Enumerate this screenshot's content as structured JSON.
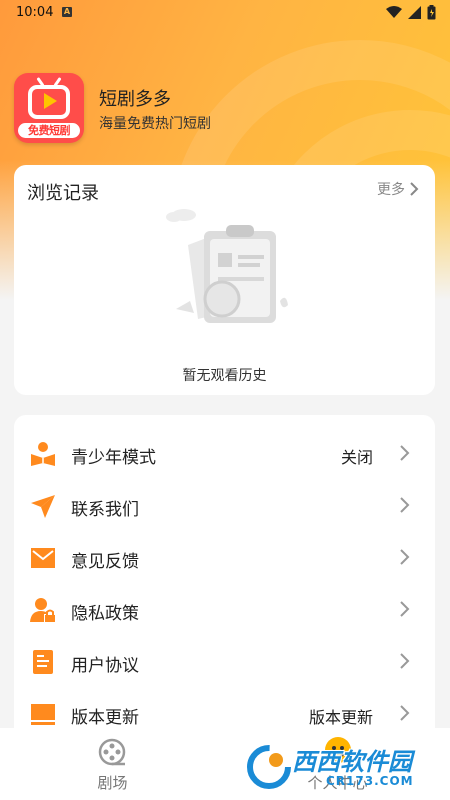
{
  "status_bar": {
    "time": "10:04",
    "notif_icon": "A"
  },
  "app": {
    "name": "短剧多多",
    "subtitle": "海量免费热门短剧",
    "logo_badge": "免费短剧"
  },
  "history": {
    "title": "浏览记录",
    "more_label": "更多",
    "empty_text": "暂无观看历史"
  },
  "menu": [
    {
      "icon": "youth-mode-icon",
      "label": "青少年模式",
      "value": "关闭"
    },
    {
      "icon": "send-icon",
      "label": "联系我们",
      "value": ""
    },
    {
      "icon": "mail-icon",
      "label": "意见反馈",
      "value": ""
    },
    {
      "icon": "privacy-icon",
      "label": "隐私政策",
      "value": ""
    },
    {
      "icon": "document-icon",
      "label": "用户协议",
      "value": ""
    },
    {
      "icon": "monitor-icon",
      "label": "版本更新",
      "value": "版本更新"
    }
  ],
  "tabs": [
    {
      "icon": "film-reel-icon",
      "label": "剧场"
    },
    {
      "icon": "profile-icon",
      "label": "个人中心"
    }
  ],
  "watermark": {
    "brand": "西西软件园",
    "domain": "CR173.COM"
  },
  "colors": {
    "accent": "#ff8a1e",
    "header_start": "#ff9a3c",
    "header_end": "#ffc637"
  }
}
